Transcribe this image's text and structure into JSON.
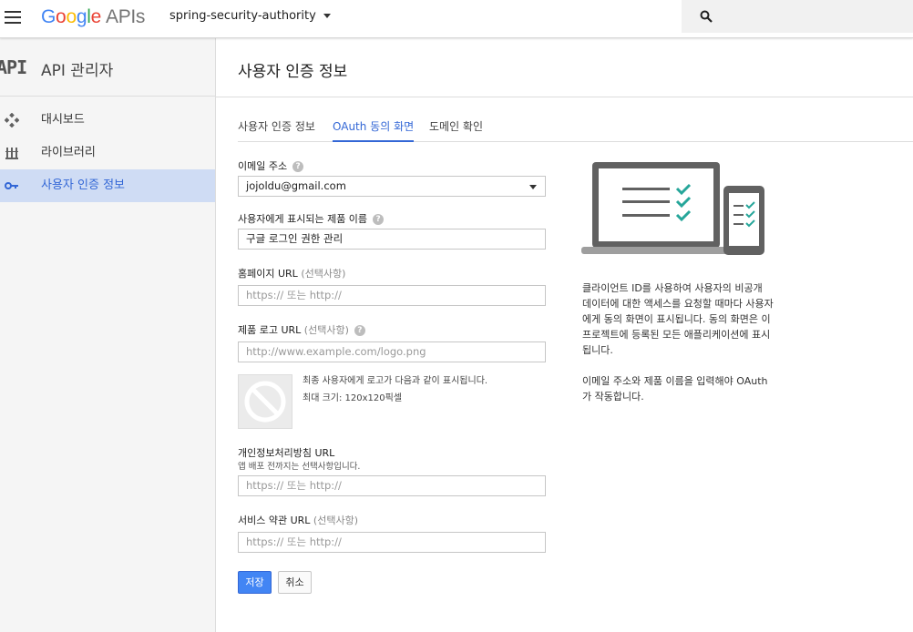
{
  "header": {
    "logo_letters": [
      "G",
      "o",
      "o",
      "g",
      "l",
      "e"
    ],
    "logo_suffix": "APIs",
    "project": "spring-security-authority"
  },
  "sidebar": {
    "api_badge": "API",
    "title": "API 관리자",
    "items": [
      {
        "label": "대시보드",
        "icon": "dashboard-icon"
      },
      {
        "label": "라이브러리",
        "icon": "library-icon"
      },
      {
        "label": "사용자 인증 정보",
        "icon": "key-icon"
      }
    ]
  },
  "main": {
    "page_title": "사용자 인증 정보",
    "tabs": [
      {
        "label": "사용자 인증 정보"
      },
      {
        "label": "OAuth 동의 화면"
      },
      {
        "label": "도메인 확인"
      }
    ],
    "active_tab": "OAuth 동의 화면"
  },
  "form": {
    "email": {
      "label": "이메일 주소",
      "value": "jojoldu@gmail.com"
    },
    "product_name": {
      "label": "사용자에게 표시되는 제품 이름",
      "value": "구글 로그인 권한 관리"
    },
    "homepage": {
      "label": "홈페이지 URL",
      "optional": "(선택사항)",
      "placeholder": "https:// 또는 http://"
    },
    "logo_url": {
      "label": "제품 로고 URL",
      "optional": "(선택사항)",
      "placeholder": "http://www.example.com/logo.png"
    },
    "logo_note_line1": "최종 사용자에게 로고가 다음과 같이 표시됩니다.",
    "logo_note_line2": "최대 크기: 120x120픽셀",
    "privacy": {
      "label": "개인정보처리방침 URL",
      "note": "앱 배포 전까지는 선택사항입니다.",
      "placeholder": "https:// 또는 http://"
    },
    "terms": {
      "label": "서비스 약관 URL",
      "optional": "(선택사항)",
      "placeholder": "https:// 또는 http://"
    },
    "help_glyph": "?",
    "save_label": "저장",
    "cancel_label": "취소"
  },
  "info": {
    "paragraph1": "클라이언트 ID를 사용하여 사용자의 비공개 데이터에 대한 액세스를 요청할 때마다 사용자에게 동의 화면이 표시됩니다. 동의 화면은 이 프로젝트에 등록된 모든 애플리케이션에 표시됩니다.",
    "paragraph2": "이메일 주소와 제품 이름을 입력해야 OAuth가 작동합니다."
  },
  "colors": {
    "accent": "#3367d6",
    "active_nav_bg": "#cfdcf4",
    "save_button": "#4285f4",
    "check_teal": "#26a69a"
  }
}
